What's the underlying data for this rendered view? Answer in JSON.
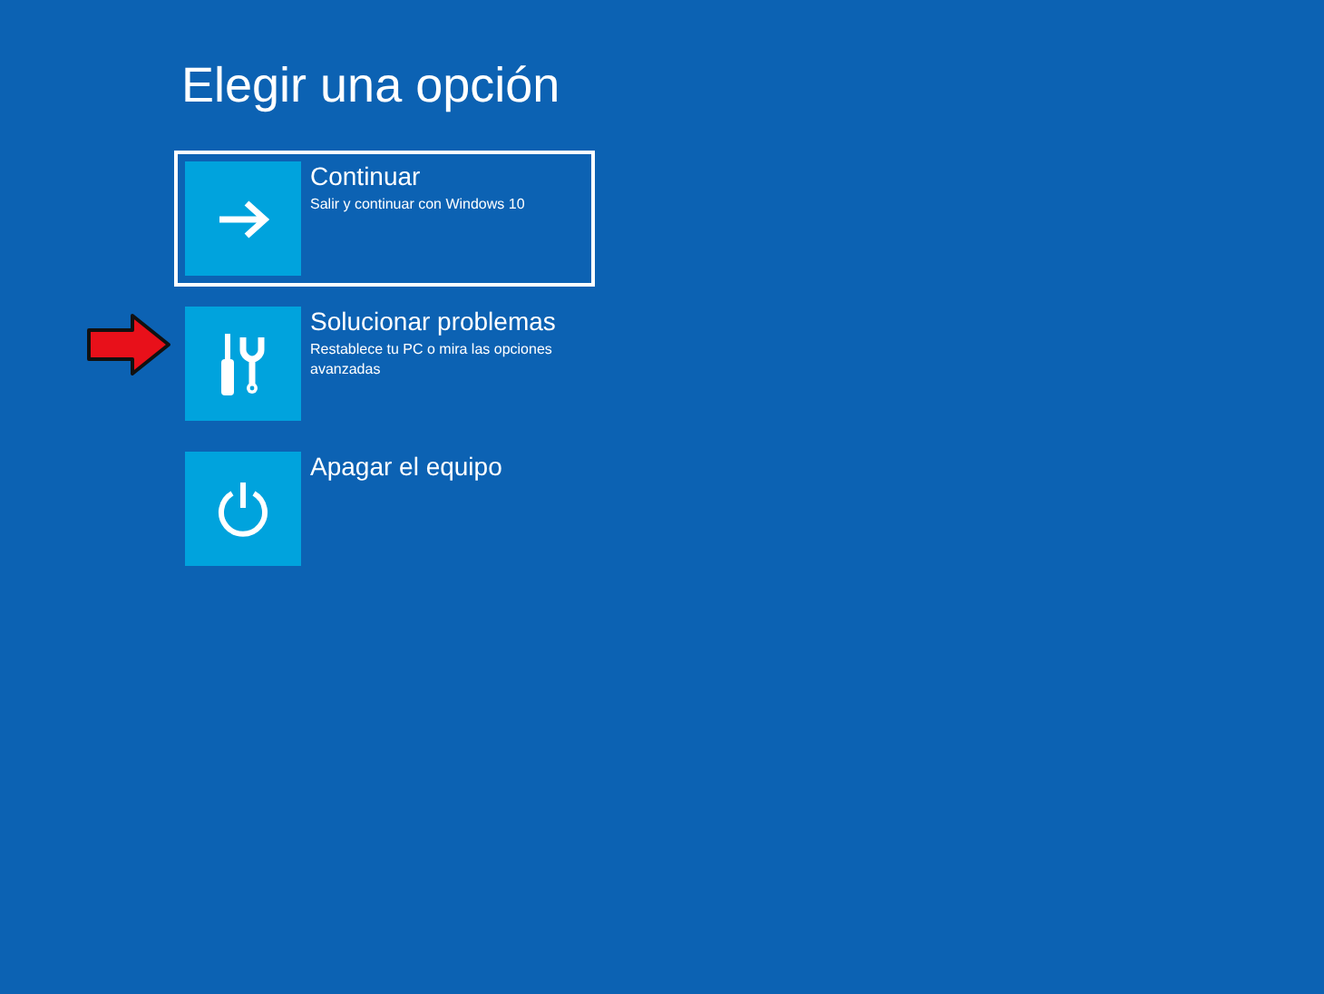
{
  "title": "Elegir una opción",
  "options": [
    {
      "label": "Continuar",
      "description": "Salir y continuar con Windows 10",
      "selected": true,
      "highlighted": false
    },
    {
      "label": "Solucionar problemas",
      "description": "Restablece tu PC o mira las opciones avanzadas",
      "selected": false,
      "highlighted": true
    },
    {
      "label": "Apagar el equipo",
      "selected": false,
      "highlighted": false
    }
  ]
}
